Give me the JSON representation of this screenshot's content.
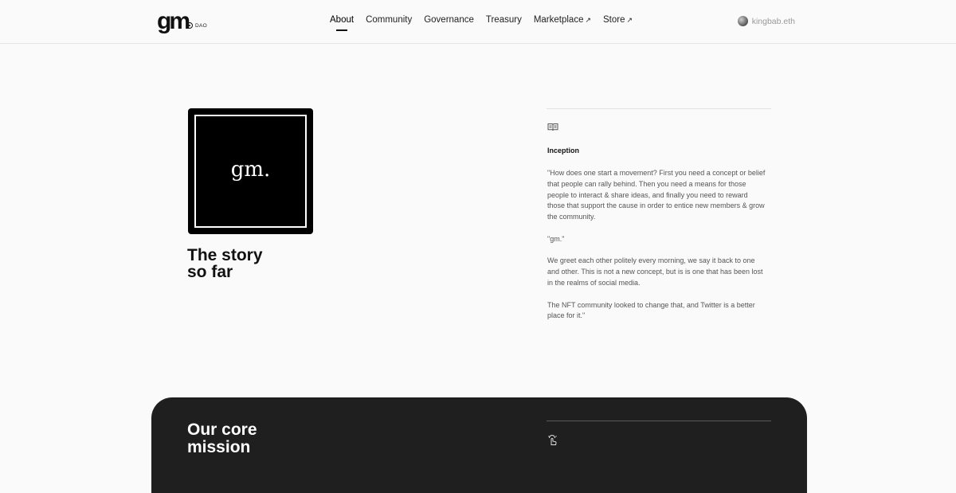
{
  "header": {
    "logo": {
      "mark": "gm",
      "sub": "DAO"
    },
    "nav": [
      {
        "label": "About",
        "active": true,
        "external": false
      },
      {
        "label": "Community",
        "active": false,
        "external": false
      },
      {
        "label": "Governance",
        "active": false,
        "external": false
      },
      {
        "label": "Treasury",
        "active": false,
        "external": false
      },
      {
        "label": "Marketplace",
        "active": false,
        "external": true
      },
      {
        "label": "Store",
        "active": false,
        "external": true
      }
    ],
    "external_arrow": "↗",
    "account": "kingbab.eth"
  },
  "story": {
    "image_text": "gm.",
    "title_line1": "The story",
    "title_line2": "so far",
    "section_icon": "book-icon",
    "section_label": "Inception",
    "paragraphs": [
      "\"How does one start a movement? First you need a concept or belief that people can rally behind. Then you need a means for those people to interact & share ideas, and finally you need to reward those that support the cause in order to entice new members & grow the community.",
      "\"gm.\"",
      "We greet each other politely every morning, we say it back to one and other. This is not a new concept, but is is one that has been lost in the realms of social media.",
      "The NFT community looked to change that, and Twitter is a better place for it.\""
    ]
  },
  "mission": {
    "title_line1": "Our core",
    "title_line2": "mission",
    "icon": "pointer-hand-icon"
  },
  "colors": {
    "background": "#fafafa",
    "dark_panel": "#1f1f1f",
    "text": "#111111",
    "muted": "#555555"
  }
}
